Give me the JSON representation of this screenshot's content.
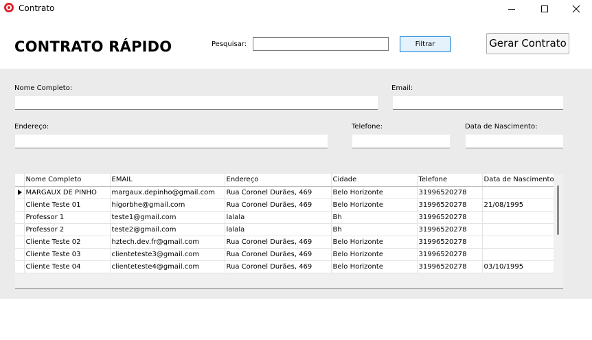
{
  "window": {
    "title": "Contrato",
    "minimize_symbol": "",
    "close_symbol": "✕"
  },
  "header": {
    "title": "CONTRATO RÁPIDO",
    "search_label": "Pesquisar:",
    "search_value": "",
    "filter_button": "Filtrar",
    "generate_button": "Gerar Contrato"
  },
  "form": {
    "name_label": "Nome Completo:",
    "name_value": "",
    "email_label": "Email:",
    "email_value": "",
    "address_label": "Endereço:",
    "address_value": "",
    "phone_label": "Telefone:",
    "phone_value": "",
    "birth_label": "Data de Nascimento:",
    "birth_value": ""
  },
  "grid": {
    "columns": [
      "Nome Completo",
      "EMAIL",
      "Endereço",
      "Cidade",
      "Telefone",
      "Data de Nascimento"
    ],
    "rows": [
      [
        "MARGAUX DE PINHO",
        "margaux.depinho@gmail.com",
        "Rua Coronel Durães, 469",
        "Belo Horizonte",
        "31996520278",
        ""
      ],
      [
        "Cliente Teste 01",
        "higorbhe@gmail.com",
        "Rua Coronel Durães, 469",
        "Belo Horizonte",
        "31996520278",
        "21/08/1995"
      ],
      [
        "Professor 1",
        "teste1@gmail.com",
        "lalala",
        "Bh",
        "31996520278",
        ""
      ],
      [
        "Professor 2",
        "teste2@gmail.com",
        "lalala",
        "Bh",
        "31996520278",
        ""
      ],
      [
        "Cliente Teste 02",
        "hztech.dev.fr@gmail.com",
        "Rua Coronel Durães, 469",
        "Belo Horizonte",
        "31996520278",
        ""
      ],
      [
        "Cliente Teste 03",
        "clienteteste3@gmail.com",
        "Rua Coronel Durães, 469",
        "Belo Horizonte",
        "31996520278",
        ""
      ],
      [
        "Cliente Teste 04",
        "clienteteste4@gmail.com",
        "Rua Coronel Durães, 469",
        "Belo Horizonte",
        "31996520278",
        "03/10/1995"
      ]
    ],
    "current_row_index": 0
  }
}
